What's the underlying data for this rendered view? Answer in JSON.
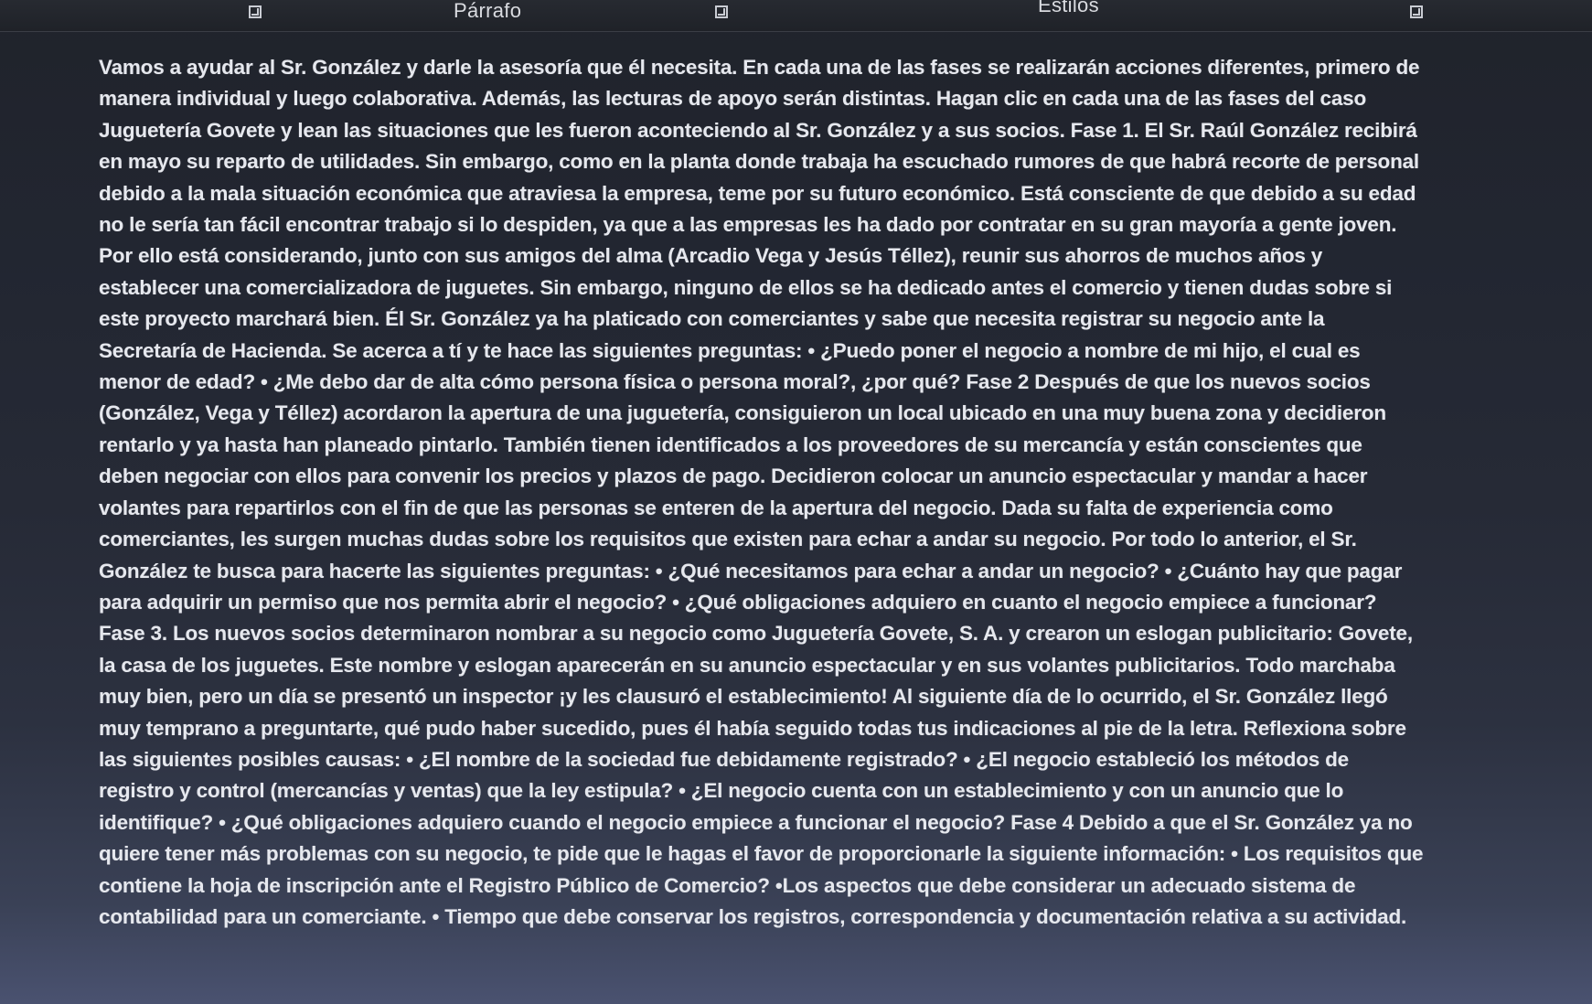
{
  "ribbon": {
    "paragraph_label": "Párrafo",
    "styles_label": "Estilos"
  },
  "document": {
    "paragraph": "Vamos a ayudar al Sr. González y darle la asesoría que él necesita. En cada una de las fases se realizarán acciones diferentes, primero de manera individual y luego colaborativa. Además, las lecturas de apoyo serán distintas. Hagan clic en cada una de las fases del caso Juguetería Govete y lean las situaciones que les fueron aconteciendo al Sr. González y a sus socios. Fase 1. El Sr. Raúl González recibirá en mayo su reparto de utilidades. Sin embargo, como en la planta donde trabaja ha escuchado rumores de que habrá recorte de personal debido a la mala situación económica que atraviesa la empresa, teme por su futuro económico. Está consciente de que debido a su edad no le sería tan fácil encontrar trabajo si lo despiden, ya que a las empresas les ha dado por contratar en su gran mayoría a gente joven. Por ello está considerando, junto con sus amigos del alma (Arcadio Vega y Jesús Téllez), reunir sus ahorros de muchos años y establecer una comercializadora de juguetes. Sin embargo, ninguno de ellos se ha dedicado antes el comercio y tienen dudas sobre si este proyecto marchará bien. Él Sr. González ya ha platicado con comerciantes y sabe que necesita registrar su negocio ante la Secretaría de Hacienda. Se acerca a tí y te hace las siguientes preguntas: • ¿Puedo poner el negocio a nombre de mi hijo, el cual es menor de edad? • ¿Me debo dar de alta cómo persona física o persona moral?, ¿por qué? Fase 2 Después de que los nuevos socios (González, Vega y Téllez) acordaron la apertura de una juguetería, consiguieron un local ubicado en una muy buena zona y decidieron rentarlo y ya hasta han planeado pintarlo. También tienen identificados a los proveedores de su mercancía y están conscientes que deben negociar con ellos para convenir los precios y plazos de pago. Decidieron colocar un anuncio espectacular y mandar a hacer volantes para repartirlos con el fin de que las personas se enteren de la apertura del negocio. Dada su falta de experiencia como comerciantes, les surgen muchas dudas sobre los requisitos que existen para echar a andar su negocio. Por todo lo anterior, el Sr. González te busca para hacerte las siguientes preguntas: • ¿Qué necesitamos para echar a andar un negocio? • ¿Cuánto hay que pagar para adquirir un permiso que nos permita abrir el negocio? • ¿Qué obligaciones adquiero en cuanto el negocio empiece a funcionar? Fase 3. Los nuevos socios determinaron nombrar a su negocio como Juguetería Govete, S. A. y crearon un eslogan publicitario: Govete, la casa de los juguetes. Este nombre y eslogan aparecerán en su anuncio espectacular y en sus volantes publicitarios. Todo marchaba muy bien, pero un día se presentó un inspector ¡y les clausuró el establecimiento! Al siguiente día de lo ocurrido, el Sr. González llegó muy temprano a preguntarte, qué pudo haber sucedido, pues él había seguido todas tus indicaciones al pie de la letra. Reflexiona sobre las siguientes posibles causas: • ¿El nombre de la sociedad fue debidamente registrado? • ¿El negocio estableció los métodos de registro y control (mercancías y ventas) que la ley estipula? • ¿El negocio cuenta con un establecimiento y con un anuncio que lo identifique? • ¿Qué obligaciones adquiero cuando el negocio empiece a funcionar el negocio? Fase 4 Debido a que el Sr. González ya no quiere tener más problemas con su negocio, te pide que le hagas el favor de proporcionarle la siguiente información: • Los requisitos que contiene la hoja de inscripción ante el Registro Público de Comercio? •Los aspectos que debe considerar un adecuado sistema de contabilidad para un comerciante. • Tiempo que debe conservar los registros, correspondencia y documentación relativa a su actividad."
  }
}
